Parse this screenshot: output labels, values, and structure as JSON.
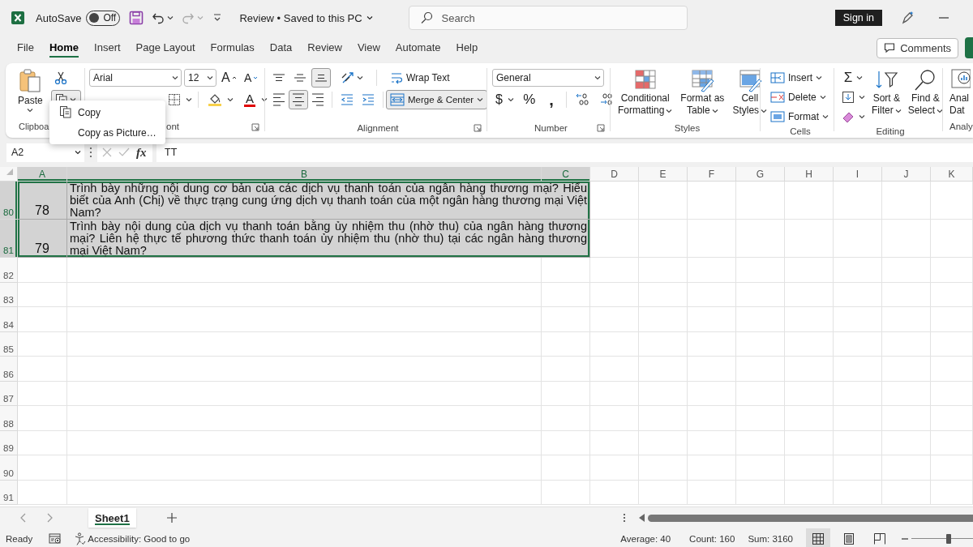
{
  "title_bar": {
    "autosave_label": "AutoSave",
    "autosave": {
      "label": "Off",
      "on": false
    },
    "document_title": "Review • Saved to this PC",
    "search": {
      "placeholder": "Search"
    },
    "sign_in": "Sign in"
  },
  "menu_tabs": [
    {
      "label": "File",
      "selected": false
    },
    {
      "label": "Home",
      "selected": true
    },
    {
      "label": "Insert",
      "selected": false
    },
    {
      "label": "Page Layout",
      "selected": false
    },
    {
      "label": "Formulas",
      "selected": false
    },
    {
      "label": "Data",
      "selected": false
    },
    {
      "label": "Review",
      "selected": false
    },
    {
      "label": "View",
      "selected": false
    },
    {
      "label": "Automate",
      "selected": false
    },
    {
      "label": "Help",
      "selected": false
    }
  ],
  "comments_button": "Comments",
  "ribbon": {
    "clipboard": {
      "paste": "Paste",
      "label": "Clipboa"
    },
    "font": {
      "name": "Arial",
      "size": "12",
      "grow": "A",
      "shrink": "A",
      "color_button": "A",
      "label": "ont"
    },
    "alignment": {
      "vertical": [
        {
          "selected": false
        },
        {
          "selected": false
        },
        {
          "selected": true
        }
      ],
      "wrap_text": "Wrap Text",
      "horizontal": [
        {
          "selected": false
        },
        {
          "selected": true
        },
        {
          "selected": false
        }
      ],
      "merge": {
        "label": "Merge & Center",
        "on": true
      },
      "label": "Alignment"
    },
    "number": {
      "format": "General",
      "currency": "$",
      "percent": "%",
      "comma": ",",
      "label": "Number"
    },
    "styles": {
      "buttons": [
        [
          "Conditional",
          "Formatting"
        ],
        [
          "Format as",
          "Table"
        ],
        [
          "Cell",
          "Styles"
        ]
      ],
      "label": "Styles"
    },
    "cells": {
      "buttons": [
        "Insert",
        "Delete",
        "Format"
      ],
      "label": "Cells"
    },
    "editing": {
      "sum": "Σ",
      "buttons": [
        [
          "Sort &",
          "Filter"
        ],
        [
          "Find &",
          "Select"
        ]
      ],
      "label": "Editing"
    },
    "analyze": {
      "lines": [
        "Anal",
        "Dat"
      ],
      "label": "Analy"
    }
  },
  "context_menu": {
    "open": true,
    "items": [
      "Copy",
      "Copy as Picture…"
    ]
  },
  "formula_bar": {
    "name_box": "A2",
    "fx": "fx",
    "formula": "TT"
  },
  "sheet": {
    "columns": [
      {
        "label": "A",
        "selected": true
      },
      {
        "label": "B",
        "selected": true
      },
      {
        "label": "C",
        "selected": true
      },
      {
        "label": "D",
        "selected": false
      },
      {
        "label": "E",
        "selected": false
      },
      {
        "label": "F",
        "selected": false
      },
      {
        "label": "G",
        "selected": false
      },
      {
        "label": "H",
        "selected": false
      },
      {
        "label": "I",
        "selected": false
      },
      {
        "label": "J",
        "selected": false
      },
      {
        "label": "K",
        "selected": false
      }
    ],
    "rows": [
      {
        "header": "80",
        "selected": true,
        "cells": [
          "78",
          "Trình bày những nội dung cơ bản của các dịch vụ thanh toán của ngân hàng thương mại? Hiểu biết của Anh (Chị) về thực trạng cung ứng dịch vụ thanh toán của một ngân hàng thương mại Việt Nam?"
        ]
      },
      {
        "header": "81",
        "selected": true,
        "cells": [
          "79",
          "Trình bày nội dung của dịch vụ thanh toán bằng ủy nhiệm thu (nhờ thu) của ngân hàng thương mại? Liên hệ thực tế phương thức thanh toán ủy nhiệm thu (nhờ thu) tại các ngân hàng thương mại Việt Nam?"
        ]
      },
      {
        "header": "82",
        "selected": false
      },
      {
        "header": "83",
        "selected": false
      },
      {
        "header": "84",
        "selected": false
      },
      {
        "header": "85",
        "selected": false
      },
      {
        "header": "86",
        "selected": false
      },
      {
        "header": "87",
        "selected": false
      },
      {
        "header": "88",
        "selected": false
      },
      {
        "header": "89",
        "selected": false
      },
      {
        "header": "90",
        "selected": false
      },
      {
        "header": "91",
        "selected": false
      }
    ]
  },
  "sheet_tabs": [
    {
      "label": "Sheet1",
      "selected": true
    }
  ],
  "status_bar": {
    "ready": "Ready",
    "accessibility": "Accessibility: Good to go",
    "average": "Average: 40",
    "count": "Count: 160",
    "sum": "Sum: 3160",
    "views": [
      {
        "selected": true
      },
      {
        "selected": false
      },
      {
        "selected": false
      }
    ],
    "zoom": {
      "level": 0.6
    }
  }
}
